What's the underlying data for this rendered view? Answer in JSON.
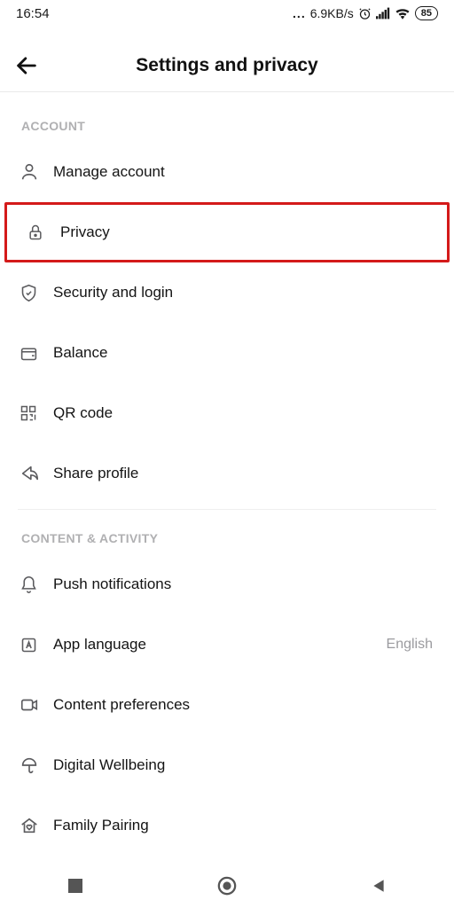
{
  "status": {
    "time": "16:54",
    "net_speed": "6.9KB/s",
    "battery": "85"
  },
  "header": {
    "title": "Settings and privacy"
  },
  "sections": {
    "account": {
      "label": "ACCOUNT",
      "items": {
        "manage": {
          "label": "Manage account"
        },
        "privacy": {
          "label": "Privacy"
        },
        "security": {
          "label": "Security and login"
        },
        "balance": {
          "label": "Balance"
        },
        "qr": {
          "label": "QR code"
        },
        "share": {
          "label": "Share profile"
        }
      }
    },
    "content": {
      "label": "CONTENT & ACTIVITY",
      "items": {
        "push": {
          "label": "Push notifications"
        },
        "lang": {
          "label": "App language",
          "value": "English"
        },
        "pref": {
          "label": "Content preferences"
        },
        "digital": {
          "label": "Digital Wellbeing"
        },
        "family": {
          "label": "Family Pairing"
        }
      }
    }
  }
}
